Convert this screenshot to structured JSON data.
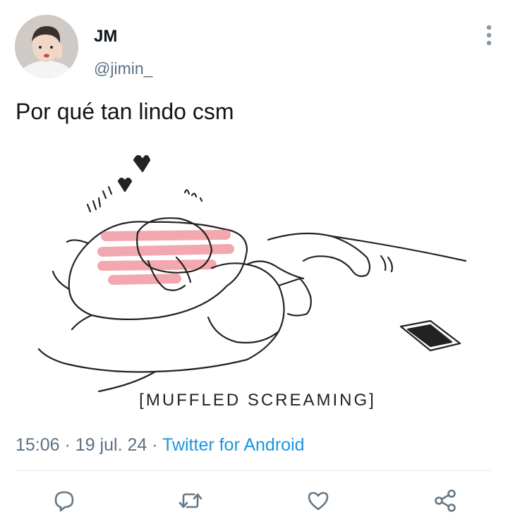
{
  "tweet": {
    "author_name": "JM",
    "author_handle": "@jimin_",
    "text": "Por qué tan lindo csm",
    "image_caption": "[MUFFLED SCREAMING]",
    "time": "15:06",
    "date": "19 jul. 24",
    "source": "Twitter for Android"
  },
  "icons": {
    "more": "more-vertical-icon",
    "reply": "reply-icon",
    "retweet": "retweet-icon",
    "like": "heart-icon",
    "share": "share-icon"
  },
  "colors": {
    "secondary_text": "#5b7083",
    "link": "#1b95e0",
    "blush": "#f29aa3"
  }
}
